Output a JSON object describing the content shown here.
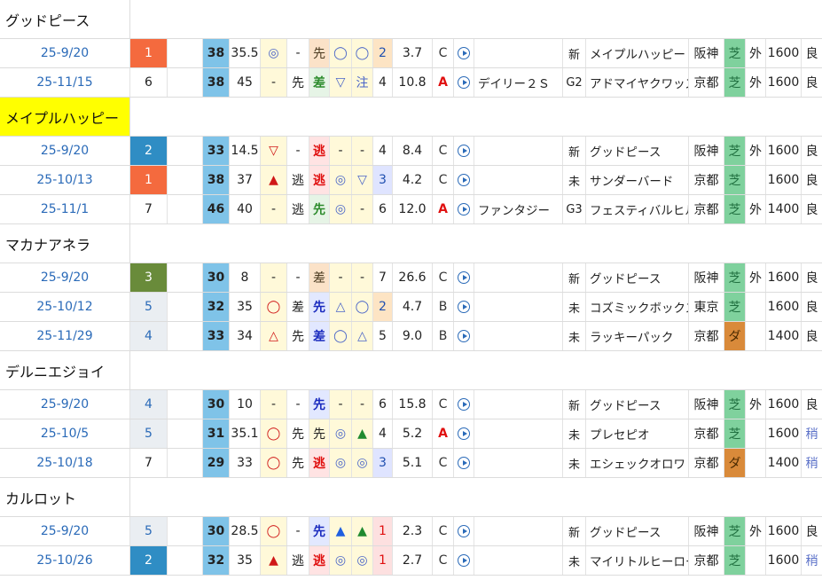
{
  "groups": [
    {
      "horse": "グッドピース",
      "highlight": false,
      "rows": [
        {
          "date": "25-9/20",
          "rank": "1",
          "rank_style": "red",
          "speed": "38",
          "v1": "35.5",
          "m1": "◎",
          "m1_style": "grey",
          "m2": "-",
          "style": "先",
          "style_style": "brown",
          "r1": "◯",
          "r2": "◯",
          "pop": "2",
          "pop_style": "orange",
          "odds": "3.7",
          "grade": "C",
          "grade_style": "plain",
          "race": "",
          "cls": "新",
          "opp": "メイプルハッピー",
          "course": "阪神",
          "surf": "芝",
          "surf_style": "turf",
          "io": "外",
          "dist": "1600",
          "cond": "良",
          "cond_style": "good"
        },
        {
          "date": "25-11/15",
          "rank": "6",
          "rank_style": "plain",
          "speed": "38",
          "v1": "45",
          "m1": "-",
          "m1_style": "plain",
          "m2": "先",
          "style": "差",
          "style_style": "green",
          "r1": "▽",
          "r2": "注",
          "pop": "4",
          "pop_style": "plain",
          "odds": "10.8",
          "grade": "A",
          "grade_style": "red",
          "race": "デイリー２Ｓ",
          "cls": "G2",
          "opp": "アドマイヤクワッズ",
          "course": "京都",
          "surf": "芝",
          "surf_style": "turf",
          "io": "外",
          "dist": "1600",
          "cond": "良",
          "cond_style": "good"
        }
      ]
    },
    {
      "horse": "メイプルハッピー",
      "highlight": true,
      "rows": [
        {
          "date": "25-9/20",
          "rank": "2",
          "rank_style": "blue",
          "speed": "33",
          "v1": "14.5",
          "m1": "▽",
          "m1_style": "red",
          "m2": "-",
          "style": "逃",
          "style_style": "red",
          "r1": "-",
          "r2": "-",
          "pop": "4",
          "pop_style": "plain",
          "odds": "8.4",
          "grade": "C",
          "grade_style": "plain",
          "race": "",
          "cls": "新",
          "opp": "グッドピース",
          "course": "阪神",
          "surf": "芝",
          "surf_style": "turf",
          "io": "外",
          "dist": "1600",
          "cond": "良",
          "cond_style": "good"
        },
        {
          "date": "25-10/13",
          "rank": "1",
          "rank_style": "red",
          "speed": "38",
          "v1": "37",
          "m1": "▲",
          "m1_style": "red",
          "m2": "逃",
          "style": "逃",
          "style_style": "red",
          "r1": "◎",
          "r2": "▽",
          "pop": "3",
          "pop_style": "blue",
          "odds": "4.2",
          "grade": "C",
          "grade_style": "plain",
          "race": "",
          "cls": "未",
          "opp": "サンダーバード",
          "course": "京都",
          "surf": "芝",
          "surf_style": "turf",
          "io": "",
          "dist": "1600",
          "cond": "良",
          "cond_style": "good"
        },
        {
          "date": "25-11/1",
          "rank": "7",
          "rank_style": "plain",
          "speed": "46",
          "v1": "40",
          "m1": "-",
          "m1_style": "plain",
          "m2": "逃",
          "style": "先",
          "style_style": "green",
          "r1": "◎",
          "r2": "-",
          "pop": "6",
          "pop_style": "plain",
          "odds": "12.0",
          "grade": "A",
          "grade_style": "red",
          "race": "ファンタジー",
          "cls": "G3",
          "opp": "フェスティバルヒル",
          "course": "京都",
          "surf": "芝",
          "surf_style": "turf",
          "io": "外",
          "dist": "1400",
          "cond": "良",
          "cond_style": "good"
        }
      ]
    },
    {
      "horse": "マカナアネラ",
      "highlight": false,
      "rows": [
        {
          "date": "25-9/20",
          "rank": "3",
          "rank_style": "green",
          "speed": "30",
          "v1": "8",
          "m1": "-",
          "m1_style": "plain",
          "m2": "-",
          "style": "差",
          "style_style": "brown",
          "r1": "-",
          "r2": "-",
          "pop": "7",
          "pop_style": "plain",
          "odds": "26.6",
          "grade": "C",
          "grade_style": "plain",
          "race": "",
          "cls": "新",
          "opp": "グッドピース",
          "course": "阪神",
          "surf": "芝",
          "surf_style": "turf",
          "io": "外",
          "dist": "1600",
          "cond": "良",
          "cond_style": "good"
        },
        {
          "date": "25-10/12",
          "rank": "5",
          "rank_style": "grey",
          "speed": "32",
          "v1": "35",
          "m1": "◯",
          "m1_style": "red",
          "m2": "差",
          "style": "先",
          "style_style": "blue",
          "r1": "△",
          "r2": "◯",
          "pop": "2",
          "pop_style": "orange",
          "odds": "4.7",
          "grade": "B",
          "grade_style": "plain",
          "race": "",
          "cls": "未",
          "opp": "コズミックボックス",
          "course": "東京",
          "surf": "芝",
          "surf_style": "turf",
          "io": "",
          "dist": "1600",
          "cond": "良",
          "cond_style": "good"
        },
        {
          "date": "25-11/29",
          "rank": "4",
          "rank_style": "grey",
          "speed": "33",
          "v1": "34",
          "m1": "△",
          "m1_style": "red",
          "m2": "先",
          "style": "差",
          "style_style": "blue",
          "r1": "◯",
          "r2": "△",
          "pop": "5",
          "pop_style": "plain",
          "odds": "9.0",
          "grade": "B",
          "grade_style": "plain",
          "race": "",
          "cls": "未",
          "opp": "ラッキーパック",
          "course": "京都",
          "surf": "ダ",
          "surf_style": "dirt",
          "io": "",
          "dist": "1400",
          "cond": "良",
          "cond_style": "good"
        }
      ]
    },
    {
      "horse": "デルニエジョイ",
      "highlight": false,
      "rows": [
        {
          "date": "25-9/20",
          "rank": "4",
          "rank_style": "grey",
          "speed": "30",
          "v1": "10",
          "m1": "-",
          "m1_style": "plain",
          "m2": "-",
          "style": "先",
          "style_style": "blue",
          "r1": "-",
          "r2": "-",
          "pop": "6",
          "pop_style": "plain",
          "odds": "15.8",
          "grade": "C",
          "grade_style": "plain",
          "race": "",
          "cls": "新",
          "opp": "グッドピース",
          "course": "阪神",
          "surf": "芝",
          "surf_style": "turf",
          "io": "外",
          "dist": "1600",
          "cond": "良",
          "cond_style": "good"
        },
        {
          "date": "25-10/5",
          "rank": "5",
          "rank_style": "grey",
          "speed": "31",
          "v1": "35.1",
          "m1": "◯",
          "m1_style": "red",
          "m2": "先",
          "style": "先",
          "style_style": "plain",
          "r1": "◎",
          "r2": "▲",
          "pop": "4",
          "pop_style": "plain",
          "odds": "5.2",
          "grade": "A",
          "grade_style": "red",
          "race": "",
          "cls": "未",
          "opp": "プレセピオ",
          "course": "京都",
          "surf": "芝",
          "surf_style": "turf",
          "io": "",
          "dist": "1600",
          "cond": "稍",
          "cond_style": "slight"
        },
        {
          "date": "25-10/18",
          "rank": "7",
          "rank_style": "plain",
          "speed": "29",
          "v1": "33",
          "m1": "◯",
          "m1_style": "red",
          "m2": "先",
          "style": "逃",
          "style_style": "red",
          "r1": "◎",
          "r2": "◎",
          "pop": "3",
          "pop_style": "blue",
          "odds": "5.1",
          "grade": "C",
          "grade_style": "plain",
          "race": "",
          "cls": "未",
          "opp": "エシェックオロワ",
          "course": "京都",
          "surf": "ダ",
          "surf_style": "dirt",
          "io": "",
          "dist": "1400",
          "cond": "稍",
          "cond_style": "slight"
        }
      ]
    },
    {
      "horse": "カルロット",
      "highlight": false,
      "rows": [
        {
          "date": "25-9/20",
          "rank": "5",
          "rank_style": "grey",
          "speed": "30",
          "v1": "28.5",
          "m1": "◯",
          "m1_style": "red",
          "m2": "-",
          "style": "先",
          "style_style": "blue",
          "r1": "▲",
          "r2": "▲",
          "pop": "1",
          "pop_style": "pink",
          "odds": "2.3",
          "grade": "C",
          "grade_style": "plain",
          "race": "",
          "cls": "新",
          "opp": "グッドピース",
          "course": "阪神",
          "surf": "芝",
          "surf_style": "turf",
          "io": "外",
          "dist": "1600",
          "cond": "良",
          "cond_style": "good"
        },
        {
          "date": "25-10/26",
          "rank": "2",
          "rank_style": "blue",
          "speed": "32",
          "v1": "35",
          "m1": "▲",
          "m1_style": "red",
          "m2": "逃",
          "style": "逃",
          "style_style": "red",
          "r1": "◎",
          "r2": "◎",
          "pop": "1",
          "pop_style": "pink",
          "odds": "2.7",
          "grade": "C",
          "grade_style": "plain",
          "race": "",
          "cls": "未",
          "opp": "マイリトルヒーロー",
          "course": "京都",
          "surf": "芝",
          "surf_style": "turf",
          "io": "",
          "dist": "1600",
          "cond": "稍",
          "cond_style": "slight"
        }
      ]
    }
  ]
}
